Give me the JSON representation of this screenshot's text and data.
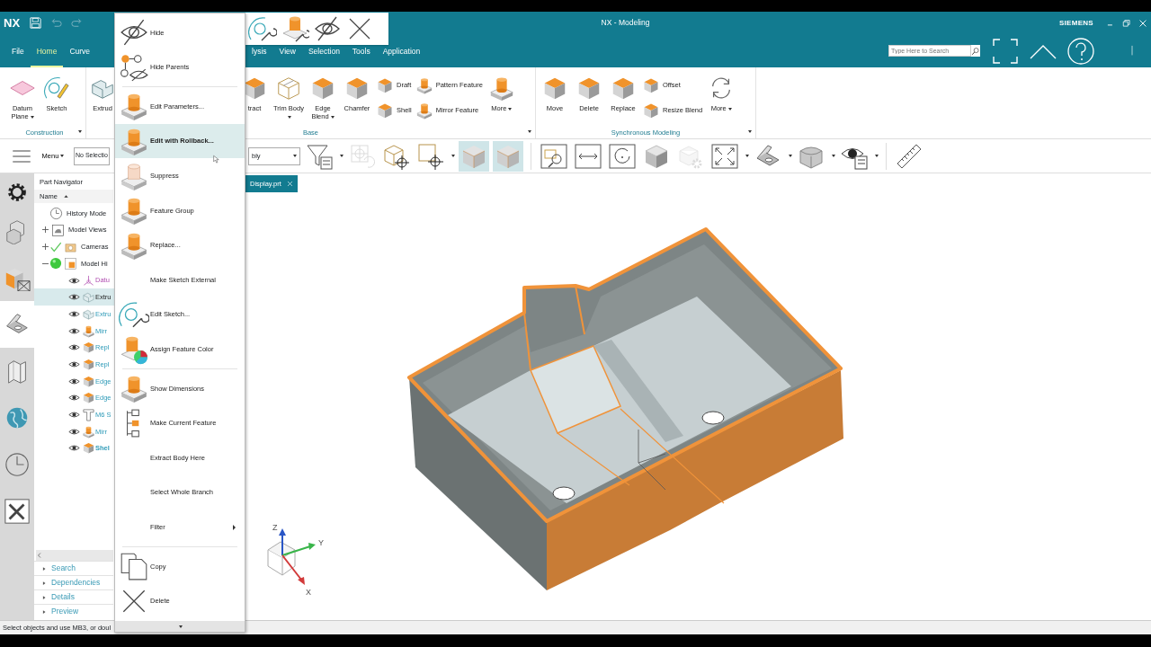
{
  "title_bar": {
    "logo": "NX",
    "title": "NX - Modeling",
    "brand": "SIEMENS"
  },
  "menu_tabs": [
    {
      "label": "File",
      "selected": false
    },
    {
      "label": "Home",
      "selected": true
    },
    {
      "label": "Curve",
      "selected": false
    },
    {
      "label": "lysis",
      "selected": false
    },
    {
      "label": "View",
      "selected": false
    },
    {
      "label": "Selection",
      "selected": false
    },
    {
      "label": "Tools",
      "selected": false
    },
    {
      "label": "Application",
      "selected": false
    }
  ],
  "search": {
    "placeholder": "Type Here to Search"
  },
  "ribbon": [
    {
      "label": "Construction",
      "launcher": true,
      "buttons": [
        {
          "kind": "large",
          "label": "Datum Plane",
          "dropdown": true
        },
        {
          "kind": "large",
          "label": "Sketch",
          "dropdown": false
        }
      ]
    },
    {
      "label": "Base",
      "launcher": true,
      "buttons": [
        {
          "kind": "large",
          "label": "Extrud",
          "dropdown": false
        },
        {
          "kind": "large",
          "label": "tract",
          "dropdown": false
        },
        {
          "kind": "large",
          "label": "Trim Body",
          "dropdown": true
        },
        {
          "kind": "large",
          "label": "Edge Blend",
          "dropdown": true
        },
        {
          "kind": "large",
          "label": "Chamfer",
          "dropdown": false
        },
        {
          "kind": "small",
          "label": "Draft",
          "dropdown": false
        },
        {
          "kind": "small",
          "label": "Shell",
          "dropdown": false
        },
        {
          "kind": "small",
          "label": "Pattern Feature",
          "dropdown": false
        },
        {
          "kind": "small",
          "label": "Mirror Feature",
          "dropdown": false
        },
        {
          "kind": "large",
          "label": "More",
          "dropdown": true
        }
      ]
    },
    {
      "label": "Synchronous Modeling",
      "launcher": true,
      "buttons": [
        {
          "kind": "large",
          "label": "Move",
          "dropdown": false
        },
        {
          "kind": "large",
          "label": "Delete",
          "dropdown": false
        },
        {
          "kind": "large",
          "label": "Replace",
          "dropdown": false
        },
        {
          "kind": "small",
          "label": "Offset",
          "dropdown": false
        },
        {
          "kind": "small",
          "label": "Resize Blend",
          "dropdown": false
        },
        {
          "kind": "large",
          "label": "More",
          "dropdown": true
        }
      ]
    }
  ],
  "toolbar": {
    "menu_label": "Menu",
    "selection_filter": "No Selectio",
    "scope": "bly",
    "buttons": [
      {
        "kind": "button",
        "on": false,
        "disabled": false,
        "dropdown": true
      },
      {
        "kind": "button",
        "on": false,
        "disabled": true,
        "dropdown": false
      },
      {
        "kind": "button",
        "on": false,
        "disabled": false,
        "dropdown": false
      },
      {
        "kind": "button",
        "on": false,
        "disabled": false,
        "dropdown": true
      },
      {
        "kind": "button",
        "on": true,
        "disabled": false,
        "dropdown": false
      },
      {
        "kind": "button",
        "on": true,
        "disabled": false,
        "dropdown": false
      },
      {
        "kind": "separator"
      },
      {
        "kind": "button",
        "on": false,
        "disabled": false,
        "dropdown": false
      },
      {
        "kind": "button",
        "on": false,
        "disabled": false,
        "dropdown": false
      },
      {
        "kind": "button",
        "on": false,
        "disabled": false,
        "dropdown": false
      },
      {
        "kind": "button",
        "on": false,
        "disabled": false,
        "dropdown": false
      },
      {
        "kind": "button",
        "on": false,
        "disabled": true,
        "dropdown": false
      },
      {
        "kind": "button",
        "on": false,
        "disabled": false,
        "dropdown": true
      },
      {
        "kind": "button",
        "on": false,
        "disabled": false,
        "dropdown": true
      },
      {
        "kind": "button",
        "on": false,
        "disabled": false,
        "dropdown": true
      },
      {
        "kind": "button",
        "on": false,
        "disabled": false,
        "dropdown": true
      },
      {
        "kind": "separator"
      },
      {
        "kind": "button",
        "on": false,
        "disabled": false,
        "dropdown": false
      }
    ]
  },
  "resource_bar": [
    {
      "selected": false
    },
    {
      "selected": false
    },
    {
      "selected": false
    },
    {
      "selected": true
    },
    {
      "selected": false
    },
    {
      "selected": false
    },
    {
      "selected": false
    },
    {
      "selected": false
    }
  ],
  "part_navigator": {
    "title": "Part Navigator",
    "column": "Name",
    "sort_ascending": true,
    "tree": [
      {
        "kind": "leaf",
        "label": "History Mode",
        "checked": false,
        "current": false
      },
      {
        "kind": "group",
        "label": "Model Views",
        "expanded": false,
        "checked": false,
        "current": false
      },
      {
        "kind": "group",
        "label": "Cameras",
        "expanded": false,
        "checked": true,
        "current": false
      },
      {
        "kind": "group",
        "label": "Model Hi",
        "expanded": true,
        "checked": false,
        "current": true,
        "children": [
          {
            "kind": "datum",
            "label": "Datu",
            "selected": false,
            "current": false
          },
          {
            "kind": "feature",
            "label": "Extru",
            "selected": true,
            "current": false
          },
          {
            "kind": "feature",
            "label": "Extru",
            "selected": false,
            "current": false
          },
          {
            "kind": "feature",
            "label": "Mirr",
            "selected": false,
            "current": false
          },
          {
            "kind": "feature",
            "label": "Repl",
            "selected": false,
            "current": false
          },
          {
            "kind": "feature",
            "label": "Repl",
            "selected": false,
            "current": false
          },
          {
            "kind": "feature",
            "label": "Edge",
            "selected": false,
            "current": false
          },
          {
            "kind": "feature",
            "label": "Edge",
            "selected": false,
            "current": false
          },
          {
            "kind": "feature",
            "label": "M6 S",
            "selected": false,
            "current": false
          },
          {
            "kind": "feature",
            "label": "Mirr",
            "selected": false,
            "current": false
          },
          {
            "kind": "feature",
            "label": "Shel",
            "selected": false,
            "current": true
          }
        ]
      }
    ],
    "sections": [
      {
        "label": "Search",
        "expanded": false
      },
      {
        "label": "Dependencies",
        "expanded": false
      },
      {
        "label": "Details",
        "expanded": false
      },
      {
        "label": "Preview",
        "expanded": false
      }
    ]
  },
  "document_tab": {
    "label": "Display.prt"
  },
  "context_menu": [
    {
      "kind": "item",
      "label": "Hide",
      "selected": false,
      "submenu": false
    },
    {
      "kind": "item",
      "label": "Hide Parents",
      "selected": false,
      "submenu": false
    },
    {
      "kind": "separator"
    },
    {
      "kind": "item",
      "label": "Edit Parameters...",
      "selected": false,
      "submenu": false
    },
    {
      "kind": "item",
      "label": "Edit with Rollback...",
      "selected": true,
      "submenu": false
    },
    {
      "kind": "item",
      "label": "Suppress",
      "selected": false,
      "submenu": false
    },
    {
      "kind": "item",
      "label": "Feature Group",
      "selected": false,
      "submenu": false
    },
    {
      "kind": "item",
      "label": "Replace...",
      "selected": false,
      "submenu": false
    },
    {
      "kind": "item",
      "label": "Make Sketch External",
      "selected": false,
      "submenu": false
    },
    {
      "kind": "item",
      "label": "Edit Sketch...",
      "selected": false,
      "submenu": false
    },
    {
      "kind": "item",
      "label": "Assign Feature Color",
      "selected": false,
      "submenu": false
    },
    {
      "kind": "separator"
    },
    {
      "kind": "item",
      "label": "Show Dimensions",
      "selected": false,
      "submenu": false
    },
    {
      "kind": "item",
      "label": "Make Current Feature",
      "selected": false,
      "submenu": false
    },
    {
      "kind": "item",
      "label": "Extract Body Here",
      "selected": false,
      "submenu": false
    },
    {
      "kind": "item",
      "label": "Select Whole Branch",
      "selected": false,
      "submenu": false
    },
    {
      "kind": "item",
      "label": "Filter",
      "selected": false,
      "submenu": true
    },
    {
      "kind": "separator"
    },
    {
      "kind": "item",
      "label": "Copy",
      "selected": false,
      "submenu": false
    },
    {
      "kind": "item",
      "label": "Delete",
      "selected": false,
      "submenu": false
    }
  ],
  "triad": {
    "x": "X",
    "y": "Y",
    "z": "Z"
  },
  "status_bar": "Select objects and use MB3, or doul"
}
